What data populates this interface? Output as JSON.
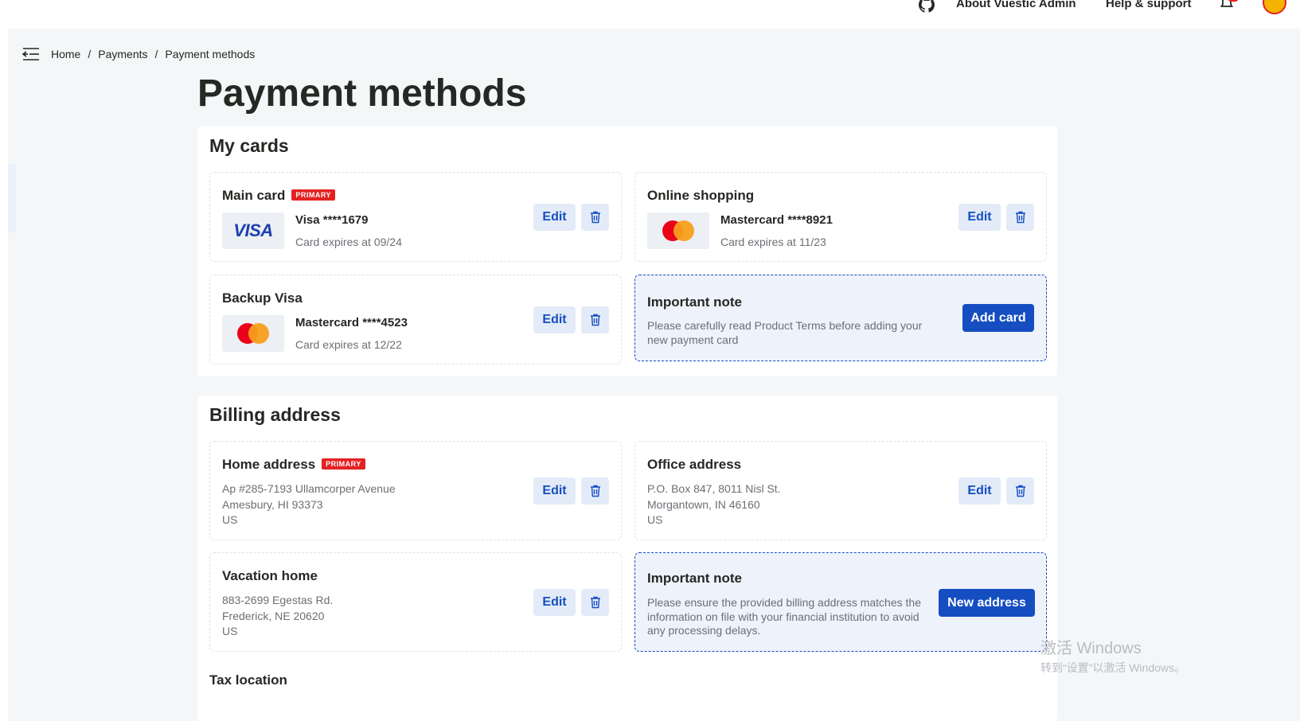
{
  "topnav": {
    "about": "About Vuestic Admin",
    "help": "Help & support"
  },
  "breadcrumb": [
    "Home",
    "Payments",
    "Payment methods"
  ],
  "page_title": "Payment methods",
  "cards_section": {
    "title": "My cards",
    "cards": [
      {
        "title": "Main card",
        "badge": "PRIMARY",
        "brand": "VISA",
        "number": "Visa ****1679",
        "expires": "Card expires at 09/24",
        "edit": "Edit"
      },
      {
        "title": "Online shopping",
        "number": "Mastercard ****8921",
        "expires": "Card expires at 11/23",
        "edit": "Edit"
      },
      {
        "title": "Backup Visa",
        "number": "Mastercard ****4523",
        "expires": "Card expires at 12/22",
        "edit": "Edit"
      }
    ],
    "note": {
      "title": "Important note",
      "text": "Please carefully read Product Terms before adding your new payment card",
      "button": "Add card"
    }
  },
  "billing_section": {
    "title": "Billing address",
    "addresses": [
      {
        "title": "Home address",
        "badge": "PRIMARY",
        "line1": "Ap #285-7193 Ullamcorper Avenue",
        "line2": "Amesbury, HI 93373",
        "line3": "US",
        "edit": "Edit"
      },
      {
        "title": "Office address",
        "line1": "P.O. Box 847, 8011 Nisl St.",
        "line2": "Morgantown, IN 46160",
        "line3": "US",
        "edit": "Edit"
      },
      {
        "title": "Vacation home",
        "line1": "883-2699 Egestas Rd.",
        "line2": "Frederick, NE 20620",
        "line3": "US",
        "edit": "Edit"
      }
    ],
    "note": {
      "title": "Important note",
      "text": "Please ensure the provided billing address matches the information on file with your financial institution to avoid any processing delays.",
      "button": "New address"
    },
    "tax_title": "Tax location"
  },
  "watermark": {
    "line1": "激活 Windows",
    "line2": "转到“设置”以激活 Windows。"
  },
  "colors": {
    "accent": "#154ec1",
    "badge": "#e42222",
    "background": "#f4f6f8"
  },
  "icons": {
    "menu": "menu-collapse-icon",
    "github": "github-icon",
    "bell": "bell-icon",
    "delete": "trash-icon"
  }
}
